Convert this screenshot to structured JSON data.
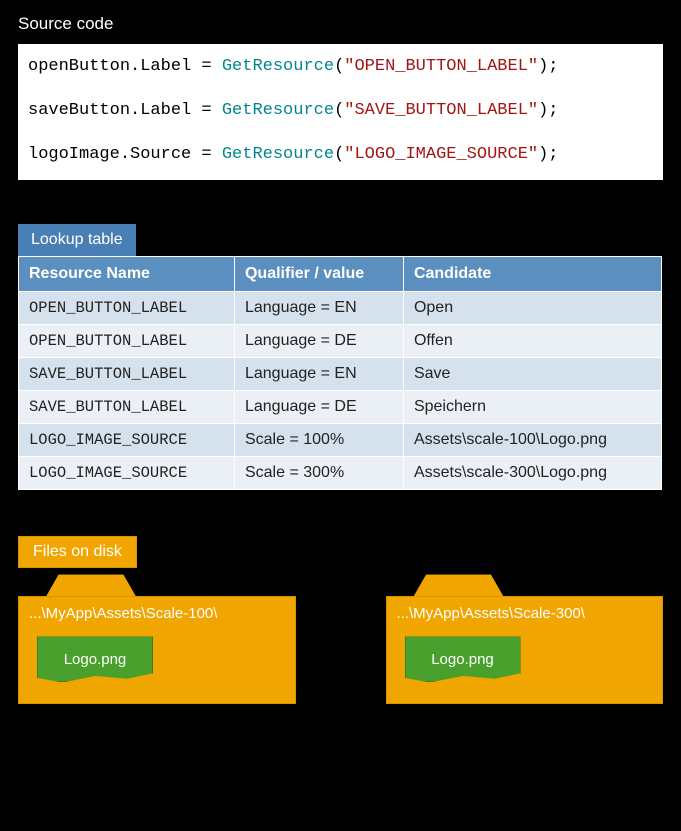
{
  "source": {
    "title": "Source code",
    "lines": [
      {
        "target": "openButton.Label",
        "fn": "GetResource",
        "arg": "\"OPEN_BUTTON_LABEL\""
      },
      {
        "target": "saveButton.Label",
        "fn": "GetResource",
        "arg": "\"SAVE_BUTTON_LABEL\""
      },
      {
        "target": "logoImage.Source",
        "fn": "GetResource",
        "arg": "\"LOGO_IMAGE_SOURCE\""
      }
    ]
  },
  "lookup": {
    "tab": "Lookup table",
    "headers": {
      "c1": "Resource Name",
      "c2": "Qualifier / value",
      "c3": "Candidate"
    },
    "rows": [
      {
        "name": "OPEN_BUTTON_LABEL",
        "qual": "Language = EN",
        "cand": "Open"
      },
      {
        "name": "OPEN_BUTTON_LABEL",
        "qual": "Language = DE",
        "cand": "Offen"
      },
      {
        "name": "SAVE_BUTTON_LABEL",
        "qual": "Language = EN",
        "cand": "Save"
      },
      {
        "name": "SAVE_BUTTON_LABEL",
        "qual": "Language = DE",
        "cand": "Speichern"
      },
      {
        "name": "LOGO_IMAGE_SOURCE",
        "qual": "Scale = 100%",
        "cand": "Assets\\scale-100\\Logo.png"
      },
      {
        "name": "LOGO_IMAGE_SOURCE",
        "qual": "Scale = 300%",
        "cand": "Assets\\scale-300\\Logo.png"
      }
    ]
  },
  "files": {
    "tab": "Files on disk",
    "folders": [
      {
        "path": "...\\MyApp\\Assets\\Scale-100\\",
        "file": "Logo.png"
      },
      {
        "path": "...\\MyApp\\Assets\\Scale-300\\",
        "file": "Logo.png"
      }
    ]
  }
}
